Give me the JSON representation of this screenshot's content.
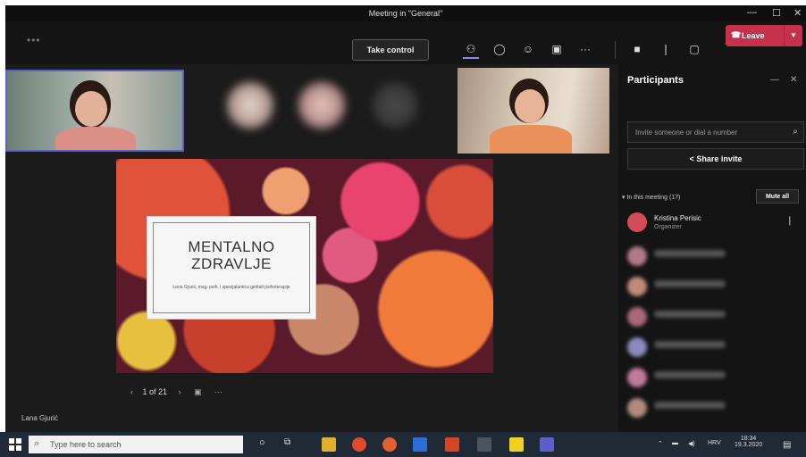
{
  "window": {
    "title": "Meeting in \"General\""
  },
  "toolbar": {
    "take_control": "Take control",
    "leave": "Leave",
    "icons": [
      "participants-icon",
      "chat-icon",
      "reactions-icon",
      "rooms-icon",
      "more-icon",
      "camera-icon",
      "mic-icon",
      "share-icon"
    ]
  },
  "slide": {
    "title_line1": "MENTALNO",
    "title_line2": "ZDRAVLJE",
    "subtitle": "Lana Gjurić, mag. psih. i specijalantica geštalt psihoterapije"
  },
  "slide_nav": {
    "page": "1 of 21"
  },
  "presenter_name": "Lana Gjurić",
  "panel": {
    "title": "Participants",
    "invite_placeholder": "Invite someone or dial a number",
    "share_invite": "Share invite",
    "in_meeting": "In this meeting (17)",
    "mute_all": "Mute all",
    "organizer_name": "Kristina Perisic",
    "organizer_role": "Organizer"
  },
  "taskbar": {
    "search_placeholder": "Type here to search",
    "lang": "HRV",
    "time": "18:34",
    "date": "19.3.2020"
  },
  "colors": {
    "accent": "#5b5fc7",
    "leave": "#c4314b",
    "background": "#1e1e1e"
  }
}
